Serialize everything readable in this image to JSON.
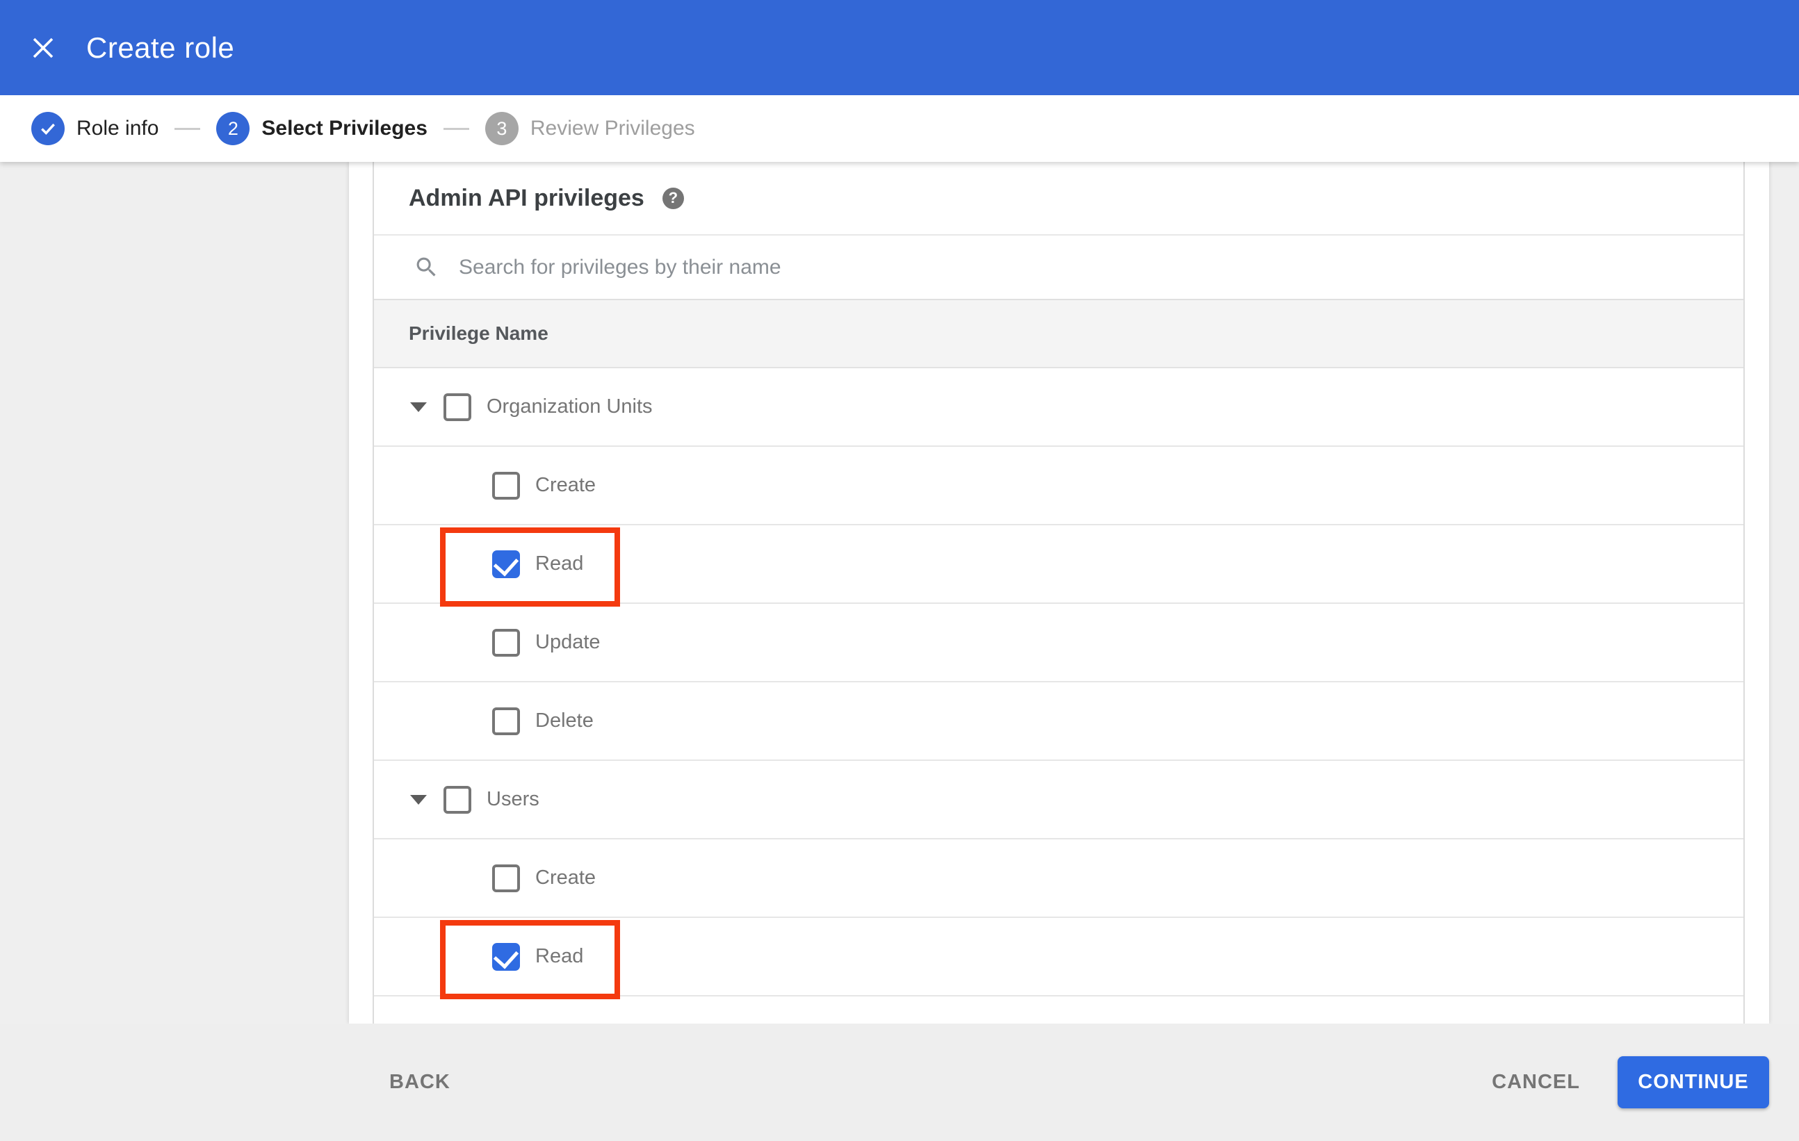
{
  "app_bar": {
    "title": "Create role"
  },
  "stepper": {
    "steps": [
      {
        "number": "1",
        "label": "Role info",
        "state": "complete"
      },
      {
        "number": "2",
        "label": "Select Privileges",
        "state": "active"
      },
      {
        "number": "3",
        "label": "Review Privileges",
        "state": "upcoming"
      }
    ]
  },
  "panel": {
    "heading": "Admin API privileges",
    "search_placeholder": "Search for privileges by their name",
    "column_header": "Privilege Name"
  },
  "privileges": [
    {
      "label": "Organization Units",
      "type": "group",
      "checked": false,
      "expanded": true,
      "highlighted": false
    },
    {
      "label": "Create",
      "type": "child",
      "checked": false,
      "highlighted": false
    },
    {
      "label": "Read",
      "type": "child",
      "checked": true,
      "highlighted": true
    },
    {
      "label": "Update",
      "type": "child",
      "checked": false,
      "highlighted": false
    },
    {
      "label": "Delete",
      "type": "child",
      "checked": false,
      "highlighted": false
    },
    {
      "label": "Users",
      "type": "group",
      "checked": false,
      "expanded": true,
      "highlighted": false
    },
    {
      "label": "Create",
      "type": "child",
      "checked": false,
      "highlighted": false
    },
    {
      "label": "Read",
      "type": "child",
      "checked": true,
      "highlighted": true
    }
  ],
  "footer": {
    "back_label": "BACK",
    "cancel_label": "CANCEL",
    "continue_label": "CONTINUE"
  },
  "icons": {
    "help_glyph": "?"
  },
  "colors": {
    "appbar_blue": "#3367d6",
    "checkbox_blue": "#2f6be2",
    "highlight_red": "#f43a0f"
  }
}
